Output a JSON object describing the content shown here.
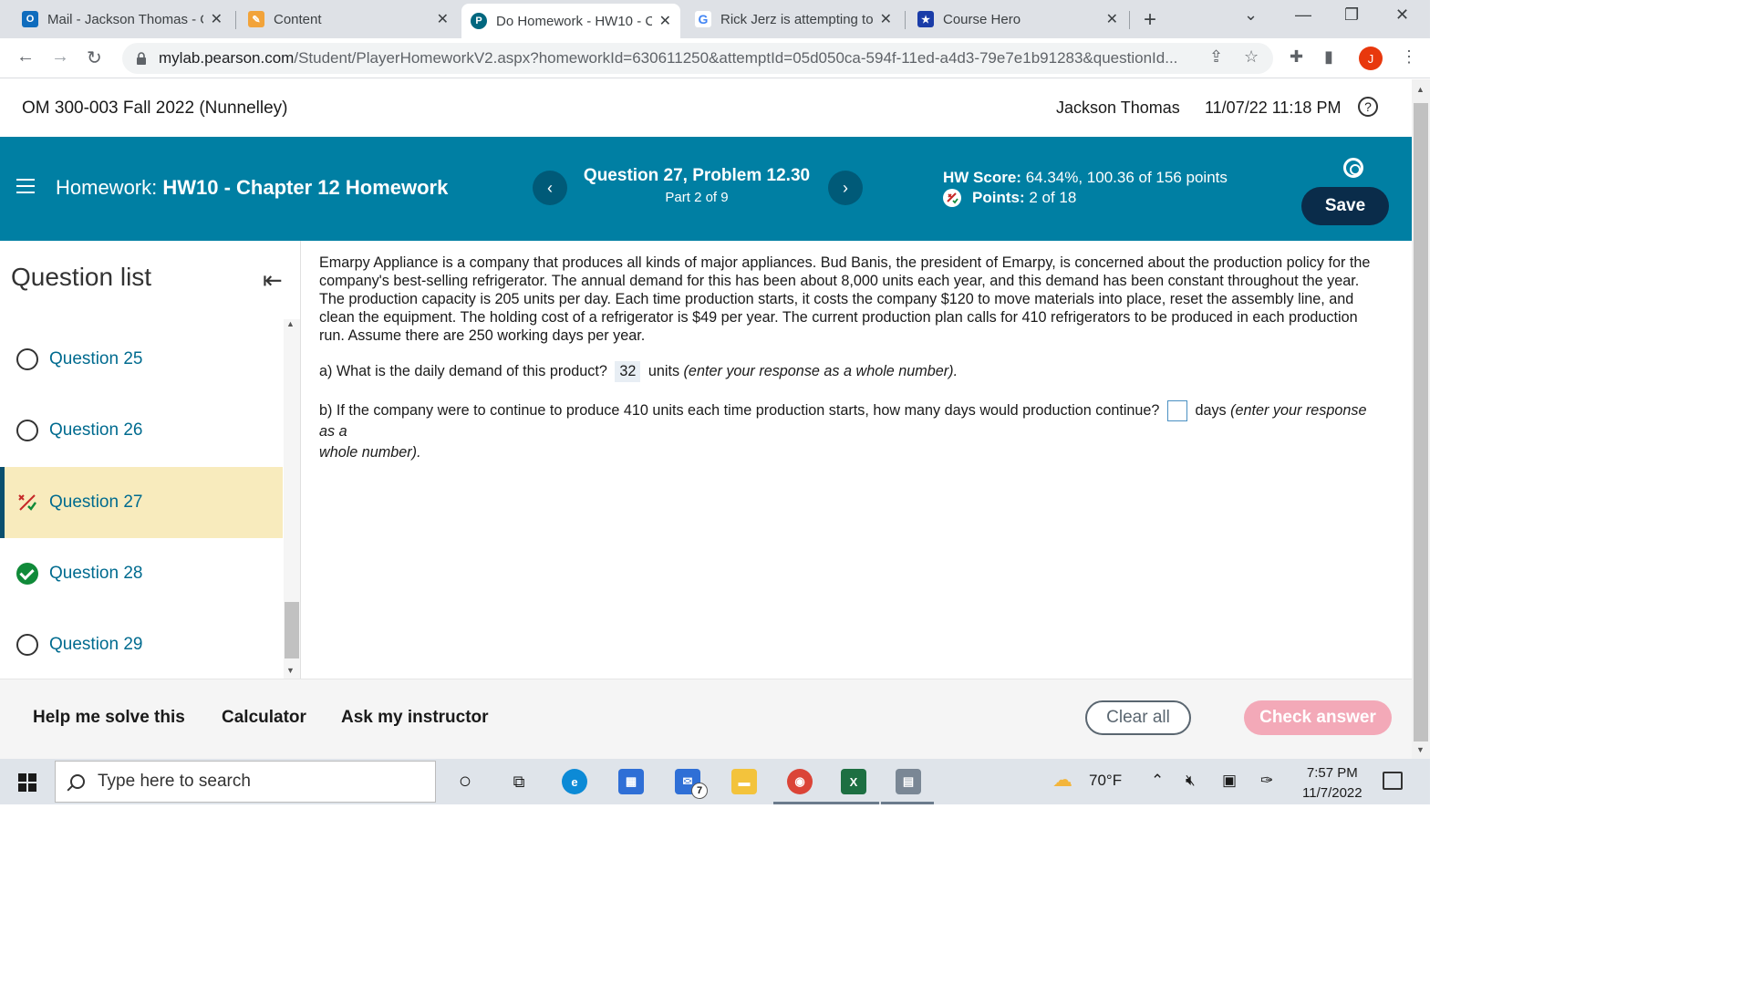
{
  "browser": {
    "tabs": [
      {
        "title": "Mail - Jackson Thomas - C",
        "icon": "outlook-icon",
        "color": "#0f6cbd"
      },
      {
        "title": "Content",
        "icon": "pencil-icon",
        "color": "#f2a33a"
      },
      {
        "title": "Do Homework - HW10 - C",
        "icon": "pearson-icon",
        "color": "#00677f",
        "active": true
      },
      {
        "title": "Rick Jerz is attempting to",
        "icon": "google-icon",
        "color": "#4285f4"
      },
      {
        "title": "Course Hero",
        "icon": "coursehero-icon",
        "color": "#1a3ca8"
      }
    ],
    "new_tab": "+",
    "url_host": "mylab.pearson.com",
    "url_path": "/Student/PlayerHomeworkV2.aspx?homeworkId=630611250&attemptId=05d050ca-594f-11ed-a4d3-79e7e1b91283&questionId...",
    "profile_initial": "J"
  },
  "course": {
    "title": "OM 300-003 Fall 2022 (Nunnelley)",
    "user": "Jackson Thomas",
    "datetime": "11/07/22 11:18 PM",
    "help": "?"
  },
  "homework": {
    "label": "Homework:",
    "name": "HW10 - Chapter 12 Homework",
    "question_title": "Question 27, Problem 12.30",
    "part": "Part 2 of 9",
    "score_label": "HW Score:",
    "score_value": "64.34%, 100.36 of 156 points",
    "points_label": "Points:",
    "points_value": "2 of 18",
    "save": "Save",
    "prev": "‹",
    "next": "›"
  },
  "question_list": {
    "title": "Question list",
    "items": [
      {
        "label": "Question 25",
        "status": "unanswered"
      },
      {
        "label": "Question 26",
        "status": "unanswered"
      },
      {
        "label": "Question 27",
        "status": "partial"
      },
      {
        "label": "Question 28",
        "status": "correct"
      },
      {
        "label": "Question 29",
        "status": "unanswered"
      }
    ]
  },
  "problem": {
    "text": "Emarpy Appliance is a company that produces all kinds of major appliances. Bud Banis, the president of Emarpy, is concerned about the production policy for the company's best-selling refrigerator. The annual demand for this has been about 8,000 units each year, and this demand has been constant throughout the year. The production capacity is 205 units per day. Each time production starts, it costs the company $120 to move materials into place, reset the assembly line, and clean the equipment. The holding cost of a refrigerator is $49 per year. The current production plan calls for 410 refrigerators to be produced in each production run. Assume there are 250 working days per year.",
    "a_prompt": "a) What is the daily demand of this product?",
    "a_answer": "32",
    "a_unit": "units",
    "a_hint": "(enter your response as a whole number).",
    "b_prompt": "b) If the company were to continue to produce 410 units each time production starts, how many days would production continue?",
    "b_unit": "days",
    "b_hint_1": "(enter your response as a",
    "b_hint_2": "whole number)."
  },
  "toolbar": {
    "help": "Help me solve this",
    "calculator": "Calculator",
    "ask": "Ask my instructor",
    "clear": "Clear all",
    "check": "Check answer"
  },
  "taskbar": {
    "search_placeholder": "Type here to search",
    "mail_badge": "7",
    "weather": "70°F",
    "time": "7:57 PM",
    "date": "11/7/2022"
  },
  "colors": {
    "banner": "#007fa3",
    "save_button": "#0a2c4a",
    "current_question": "#f8ebbd",
    "check_button": "#f3a9b8"
  }
}
